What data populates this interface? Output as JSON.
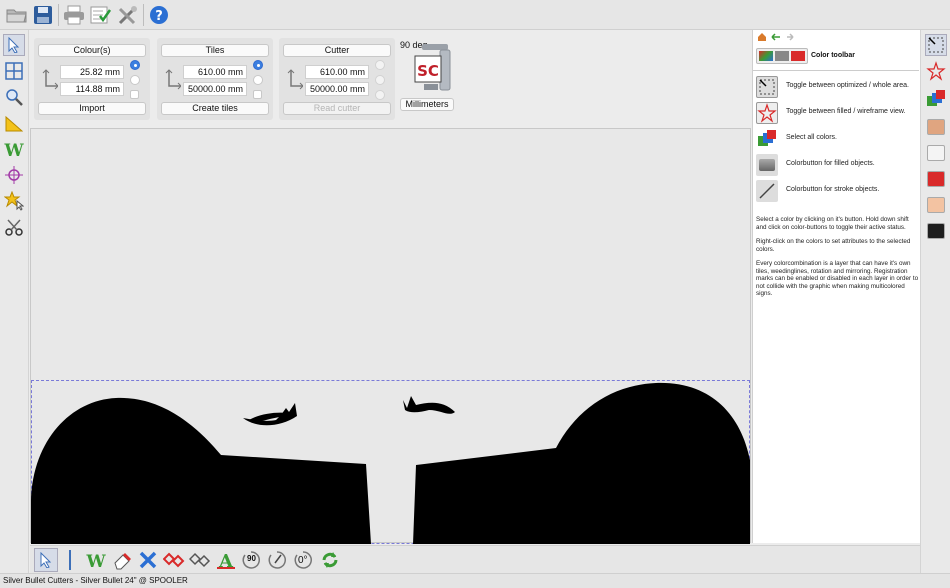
{
  "toolbar": {
    "icons": [
      "open-folder-icon",
      "save-disk-icon",
      "print-icon",
      "checklist-icon",
      "tools-icon",
      "help-icon"
    ]
  },
  "left_tools": [
    "pointer-icon",
    "grid-tile-icon",
    "zoom-icon",
    "ruler-icon",
    "weed-w-icon",
    "crosshair-icon",
    "star-select-icon",
    "scissors-icon"
  ],
  "panels": {
    "colours": {
      "title": "Colour(s)",
      "width_value": "25.82 mm",
      "height_value": "114.88 mm",
      "action_label": "Import"
    },
    "tiles": {
      "title": "Tiles",
      "width_value": "610.00 mm",
      "height_value": "50000.00 mm",
      "action_label": "Create tiles"
    },
    "cutter": {
      "title": "Cutter",
      "width_value": "610.00 mm",
      "height_value": "50000.00 mm",
      "action_label": "Read cutter"
    },
    "rotation_label": "90 deg",
    "units_label": "Millimeters"
  },
  "help": {
    "title": "Color toolbar",
    "rows": [
      {
        "icon": "optimized-area-icon",
        "text": "Toggle between optimized / whole area."
      },
      {
        "icon": "filled-wireframe-star-icon",
        "text": "Toggle between filled / wireframe view."
      },
      {
        "icon": "select-all-colors-icon",
        "text": "Select all colors."
      },
      {
        "icon": "filled-color-button-icon",
        "text": "Colorbutton for filled objects."
      },
      {
        "icon": "stroke-color-button-icon",
        "text": "Colorbutton for stroke objects."
      }
    ],
    "para1": "Select a color by clicking on it's button. Hold down shift and click on color-buttons to toggle their active status.",
    "para2": "Right-click on the colors to set attributes to the selected colors.",
    "para3": "Every colorcombination is a layer that can have it's own tiles, weedinglines, rotation and mirroring. Registration marks can be enabled or disabled in each layer in order to not collide with the graphic when making multicolored signs."
  },
  "right_strip": {
    "swatches": [
      "#e0a580",
      "#f4f4f4",
      "#d92a2a",
      "#f3c3a2",
      "#1e1e1e"
    ]
  },
  "bottom_tools": [
    "pointer-icon",
    "divider",
    "weed-w-icon",
    "eraser-icon",
    "delete-x-icon",
    "node-diamond-icon",
    "outline-diamond-icon",
    "text-a-icon",
    "rotate-90-icon",
    "rotate-free-icon",
    "rotate-zero-icon",
    "refresh-icon"
  ],
  "bottom_labels": {
    "rotate90": "90",
    "rotate0": "0°"
  },
  "status": {
    "text": "Silver Bullet Cutters - Silver Bullet 24\" @ SPOOLER"
  },
  "colors": {
    "accent": "#3c7fe0",
    "selection": "#7a7ad8",
    "artwork": "#000000"
  }
}
